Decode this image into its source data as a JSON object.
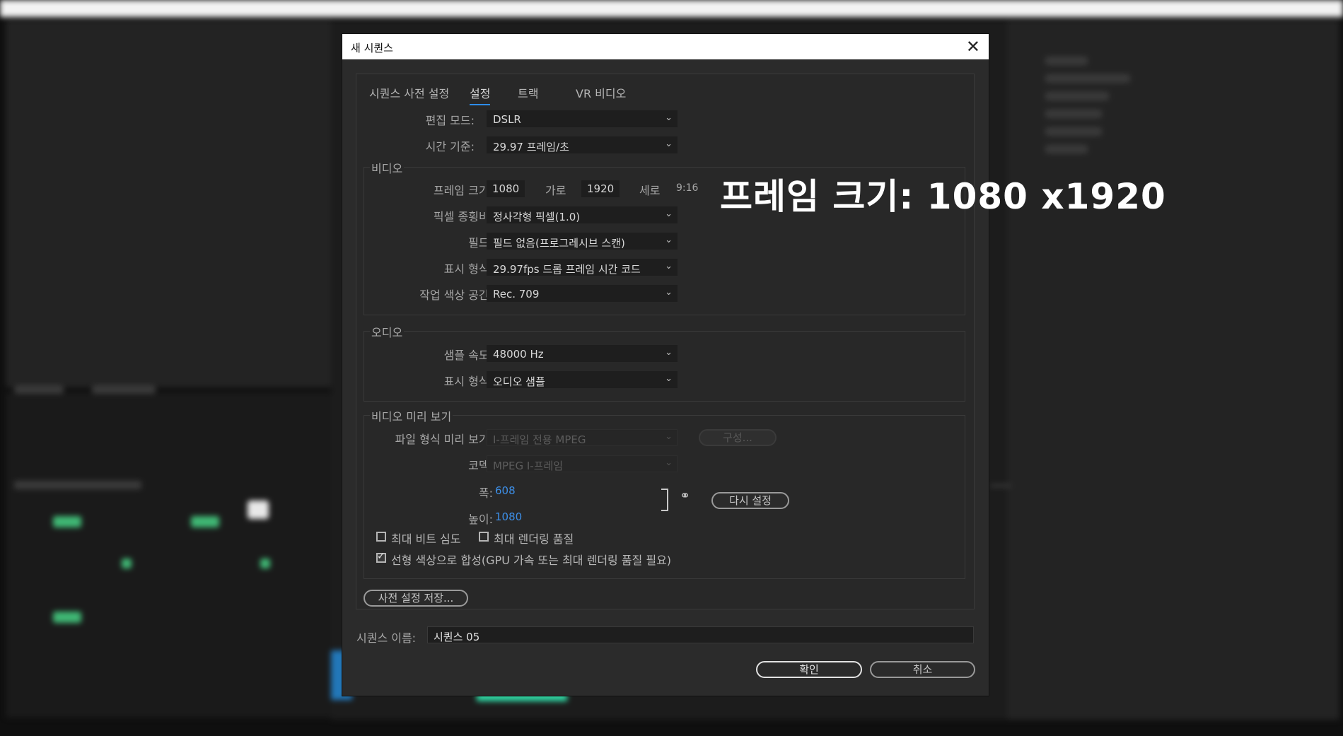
{
  "dialog": {
    "title": "새 시퀀스",
    "close_icon": "close-icon",
    "tabs": [
      "시퀀스 사전 설정",
      "설정",
      "트랙",
      "VR 비디오"
    ],
    "active_tab": "설정"
  },
  "general": {
    "edit_mode_label": "편집 모드:",
    "edit_mode_value": "DSLR",
    "timebase_label": "시간 기준:",
    "timebase_value": "29.97 프레임/초"
  },
  "video": {
    "group_title": "비디오",
    "frame_size_label": "프레임 크기:",
    "frame_width": "1080",
    "horizontal_label": "가로",
    "frame_height": "1920",
    "vertical_label": "세로",
    "aspect_ratio": "9:16",
    "pixel_aspect_label": "픽셀 종횡비:",
    "pixel_aspect_value": "정사각형 픽셀(1.0)",
    "fields_label": "필드:",
    "fields_value": "필드 없음(프로그레시브 스캔)",
    "display_format_label": "표시 형식:",
    "display_format_value": "29.97fps 드롭 프레임 시간 코드",
    "color_space_label": "작업 색상 공간:",
    "color_space_value": "Rec. 709"
  },
  "audio": {
    "group_title": "오디오",
    "sample_rate_label": "샘플 속도:",
    "sample_rate_value": "48000 Hz",
    "display_format_label": "표시 형식:",
    "display_format_value": "오디오 샘플"
  },
  "preview": {
    "group_title": "비디오 미리 보기",
    "file_format_label": "파일 형식 미리 보기:",
    "file_format_value": "I-프레임 전용 MPEG",
    "configure_label": "구성...",
    "codec_label": "코덱:",
    "codec_value": "MPEG I-프레임",
    "width_label": "폭:",
    "width_value": "608",
    "height_label": "높이:",
    "height_value": "1080",
    "reset_label": "다시 설정",
    "max_bit_depth_label": "최대 비트 심도",
    "max_render_quality_label": "최대 렌더링 품질",
    "linear_color_label": "선형 색상으로 합성(GPU 가속 또는 최대 렌더링 품질 필요)",
    "max_bit_depth_checked": false,
    "max_render_quality_checked": false,
    "linear_color_checked": true
  },
  "save_preset_label": "사전 설정 저장...",
  "sequence_name_label": "시퀀스 이름:",
  "sequence_name_value": "시퀀스 05",
  "ok_label": "확인",
  "cancel_label": "취소",
  "overlay_caption": "프레임 크기: 1080 x1920"
}
